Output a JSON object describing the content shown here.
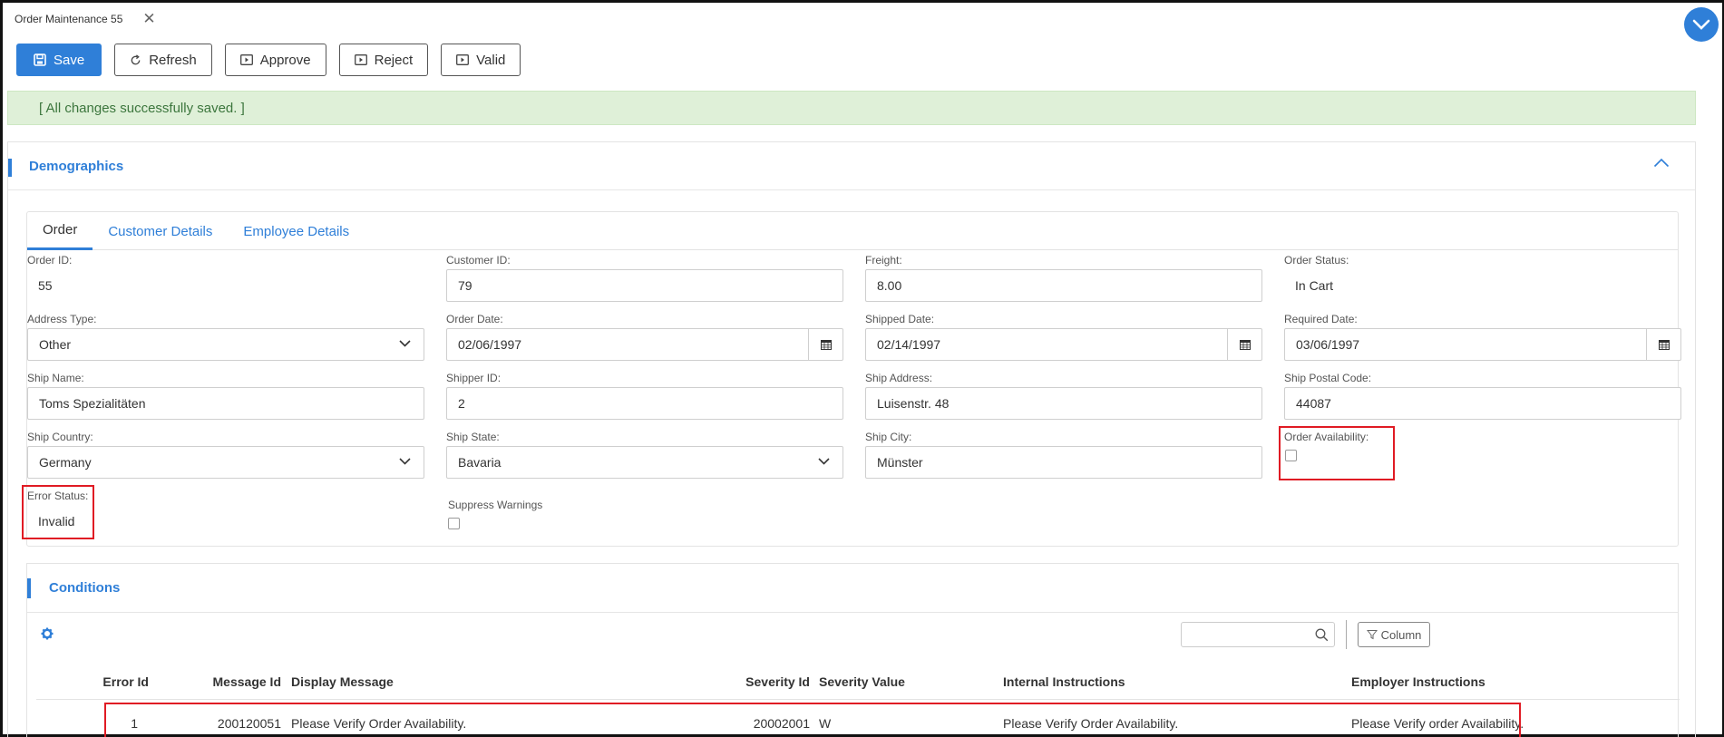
{
  "header": {
    "tab_title": "Order Maintenance 55",
    "close_glyph": "✕"
  },
  "toolbar": {
    "save_label": "Save",
    "refresh_label": "Refresh",
    "approve_label": "Approve",
    "reject_label": "Reject",
    "valid_label": "Valid"
  },
  "banner": {
    "message": "[ All changes successfully saved. ]"
  },
  "demographics": {
    "title": "Demographics",
    "tabs": [
      {
        "label": "Order"
      },
      {
        "label": "Customer Details"
      },
      {
        "label": "Employee Details"
      }
    ],
    "fields": {
      "order_id": {
        "label": "Order ID:",
        "value": "55"
      },
      "customer_id": {
        "label": "Customer ID:",
        "value": "79"
      },
      "freight": {
        "label": "Freight:",
        "value": "8.00"
      },
      "order_status": {
        "label": "Order Status:",
        "value": "In Cart"
      },
      "address_type": {
        "label": "Address Type:",
        "value": "Other"
      },
      "order_date": {
        "label": "Order Date:",
        "value": "02/06/1997"
      },
      "shipped_date": {
        "label": "Shipped Date:",
        "value": "02/14/1997"
      },
      "required_date": {
        "label": "Required Date:",
        "value": "03/06/1997"
      },
      "ship_name": {
        "label": "Ship Name:",
        "value": "Toms Spezialitäten"
      },
      "shipper_id": {
        "label": "Shipper ID:",
        "value": "2"
      },
      "ship_address": {
        "label": "Ship Address:",
        "value": "Luisenstr. 48"
      },
      "ship_postal_code": {
        "label": "Ship Postal Code:",
        "value": "44087"
      },
      "ship_country": {
        "label": "Ship Country:",
        "value": "Germany"
      },
      "ship_state": {
        "label": "Ship State:",
        "value": "Bavaria"
      },
      "ship_city": {
        "label": "Ship City:",
        "value": "Münster"
      },
      "order_availability": {
        "label": "Order Availability:",
        "checked": false
      },
      "error_status": {
        "label": "Error Status:",
        "value": "Invalid"
      },
      "suppress_warnings": {
        "label": "Suppress Warnings",
        "checked": false
      }
    }
  },
  "conditions": {
    "title": "Conditions",
    "search_placeholder": "",
    "column_button_label": "Column",
    "columns": [
      "Error Id",
      "Message Id",
      "Display Message",
      "Severity Id",
      "Severity Value",
      "Internal Instructions",
      "Employer Instructions"
    ],
    "rows": [
      {
        "error_id": "1",
        "message_id": "200120051",
        "display_message": "Please Verify Order Availability.",
        "severity_id": "20002001",
        "severity_value": "W",
        "internal_instructions": "Please Verify Order Availability.",
        "employer_instructions": "Please Verify order Availability."
      }
    ]
  },
  "colors": {
    "accent": "#2f7fd8",
    "success_bg": "#dff0d8",
    "success_text": "#3c763d",
    "highlight": "#e01b24"
  }
}
